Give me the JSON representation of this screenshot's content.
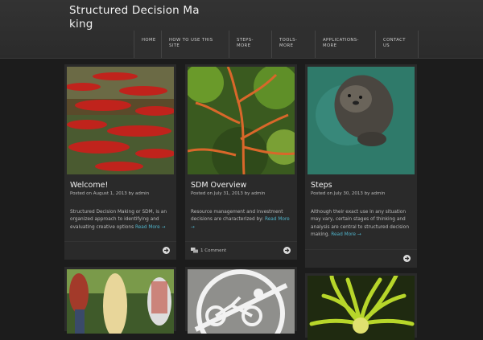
{
  "site": {
    "title": "Structured Decision Making"
  },
  "nav": {
    "items": [
      "HOME",
      "HOW TO USE THIS SITE",
      "STEPS-MORE",
      "TOOLS-MORE",
      "APPLICATIONS-MORE",
      "CONTACT US"
    ]
  },
  "posts": [
    {
      "title": "Welcome!",
      "meta": "Posted on August 1, 2013 by admin",
      "excerpt": "Structured Decision Making or SDM, is an organized approach to identifying and evaluating creative options",
      "read_more": "Read More →"
    },
    {
      "title": "SDM Overview",
      "meta": "Posted on July 31, 2013 by admin",
      "excerpt": "Resource management and investment decisions are characterized by:",
      "read_more": "Read More →",
      "comments": "1 Comment"
    },
    {
      "title": "Steps",
      "meta": "Posted on July 30, 2013 by admin",
      "excerpt": "Although their exact use in any situation may vary, certain stages of thinking and analysis are central to structured decision making.",
      "read_more": "Read More →"
    }
  ],
  "icons": {
    "more": "arrow-right-circle-icon",
    "comment": "speech-bubbles-icon"
  }
}
